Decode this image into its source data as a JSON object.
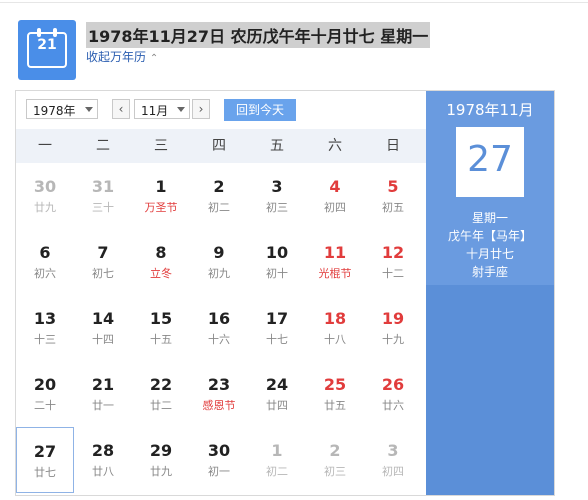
{
  "header": {
    "icon_day": "21",
    "title": "1978年11月27日 农历戊午年十月廿七 星期一",
    "collapse_label": "收起万年历",
    "collapse_icon": "⌃"
  },
  "toolbar": {
    "year_value": "1978年",
    "month_value": "11月",
    "prev_label": "‹",
    "next_label": "›",
    "today_label": "回到今天"
  },
  "weekdays": [
    "一",
    "二",
    "三",
    "四",
    "五",
    "六",
    "日"
  ],
  "days": [
    {
      "d": "30",
      "l": "廿九",
      "other": true
    },
    {
      "d": "31",
      "l": "三十",
      "other": true
    },
    {
      "d": "1",
      "l": "万圣节",
      "fest": true
    },
    {
      "d": "2",
      "l": "初二"
    },
    {
      "d": "3",
      "l": "初三"
    },
    {
      "d": "4",
      "l": "初四",
      "weekend": true
    },
    {
      "d": "5",
      "l": "初五",
      "weekend": true
    },
    {
      "d": "6",
      "l": "初六"
    },
    {
      "d": "7",
      "l": "初七"
    },
    {
      "d": "8",
      "l": "立冬",
      "fest": true
    },
    {
      "d": "9",
      "l": "初九"
    },
    {
      "d": "10",
      "l": "初十"
    },
    {
      "d": "11",
      "l": "光棍节",
      "weekend": true,
      "fest": true
    },
    {
      "d": "12",
      "l": "十二",
      "weekend": true
    },
    {
      "d": "13",
      "l": "十三"
    },
    {
      "d": "14",
      "l": "十四"
    },
    {
      "d": "15",
      "l": "十五"
    },
    {
      "d": "16",
      "l": "十六"
    },
    {
      "d": "17",
      "l": "十七"
    },
    {
      "d": "18",
      "l": "十八",
      "weekend": true
    },
    {
      "d": "19",
      "l": "十九",
      "weekend": true
    },
    {
      "d": "20",
      "l": "二十"
    },
    {
      "d": "21",
      "l": "廿一"
    },
    {
      "d": "22",
      "l": "廿二"
    },
    {
      "d": "23",
      "l": "感恩节",
      "fest": true
    },
    {
      "d": "24",
      "l": "廿四"
    },
    {
      "d": "25",
      "l": "廿五",
      "weekend": true
    },
    {
      "d": "26",
      "l": "廿六",
      "weekend": true
    },
    {
      "d": "27",
      "l": "廿七",
      "selected": true
    },
    {
      "d": "28",
      "l": "廿八"
    },
    {
      "d": "29",
      "l": "廿九"
    },
    {
      "d": "30",
      "l": "初一"
    },
    {
      "d": "1",
      "l": "初二",
      "other": true
    },
    {
      "d": "2",
      "l": "初三",
      "other": true
    },
    {
      "d": "3",
      "l": "初四",
      "other": true
    }
  ],
  "side": {
    "month_label": "1978年11月",
    "big_day": "27",
    "weekday": "星期一",
    "ganzhi": "戊午年【马年】",
    "lunar": "十月廿七",
    "zodiac": "射手座"
  },
  "colors": {
    "accent": "#5b8fd8",
    "holiday": "#e13c3c"
  }
}
